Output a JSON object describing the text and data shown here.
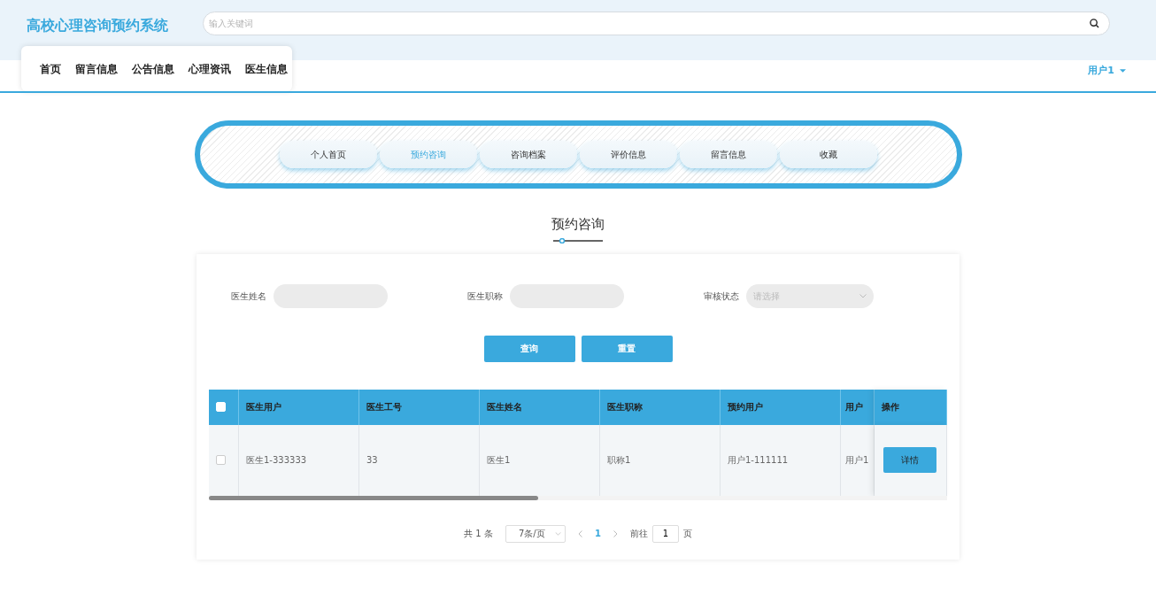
{
  "app_title": "高校心理咨询预约系统",
  "search": {
    "placeholder": "输入关键词"
  },
  "nav": [
    {
      "label": "首页"
    },
    {
      "label": "留言信息"
    },
    {
      "label": "公告信息"
    },
    {
      "label": "心理资讯"
    },
    {
      "label": "医生信息"
    }
  ],
  "user_menu": {
    "label": "用户1"
  },
  "tabs": [
    {
      "label": "个人首页",
      "selected": false
    },
    {
      "label": "预约咨询",
      "selected": true
    },
    {
      "label": "咨询档案",
      "selected": false
    },
    {
      "label": "评价信息",
      "selected": false
    },
    {
      "label": "留言信息",
      "selected": false
    },
    {
      "label": "收藏",
      "selected": false
    }
  ],
  "page_title": "预约咨询",
  "filters": [
    {
      "kind": "text",
      "label": "医生姓名"
    },
    {
      "kind": "text",
      "label": "医生职称"
    },
    {
      "kind": "select",
      "label": "审核状态",
      "placeholder": "请选择"
    }
  ],
  "buttons": [
    "查询",
    "重置"
  ],
  "table": {
    "select_all": {
      "checked": false
    },
    "columns": [
      "医生用户",
      "医生工号",
      "医生姓名",
      "医生职称",
      "预约用户",
      "用户"
    ],
    "action_column": "操作",
    "rows": [
      {
        "checked": false,
        "cells": [
          "医生1-333333",
          "33",
          "医生1",
          "职称1",
          "用户1-111111",
          "用户1"
        ],
        "action": "详情"
      }
    ]
  },
  "pagination": {
    "total": "共 1 条",
    "page_size": "7条/页",
    "pages": [
      {
        "label": "1",
        "selected": true
      }
    ],
    "goto_label": "前往",
    "goto_value": "1",
    "goto_suffix": "页"
  }
}
